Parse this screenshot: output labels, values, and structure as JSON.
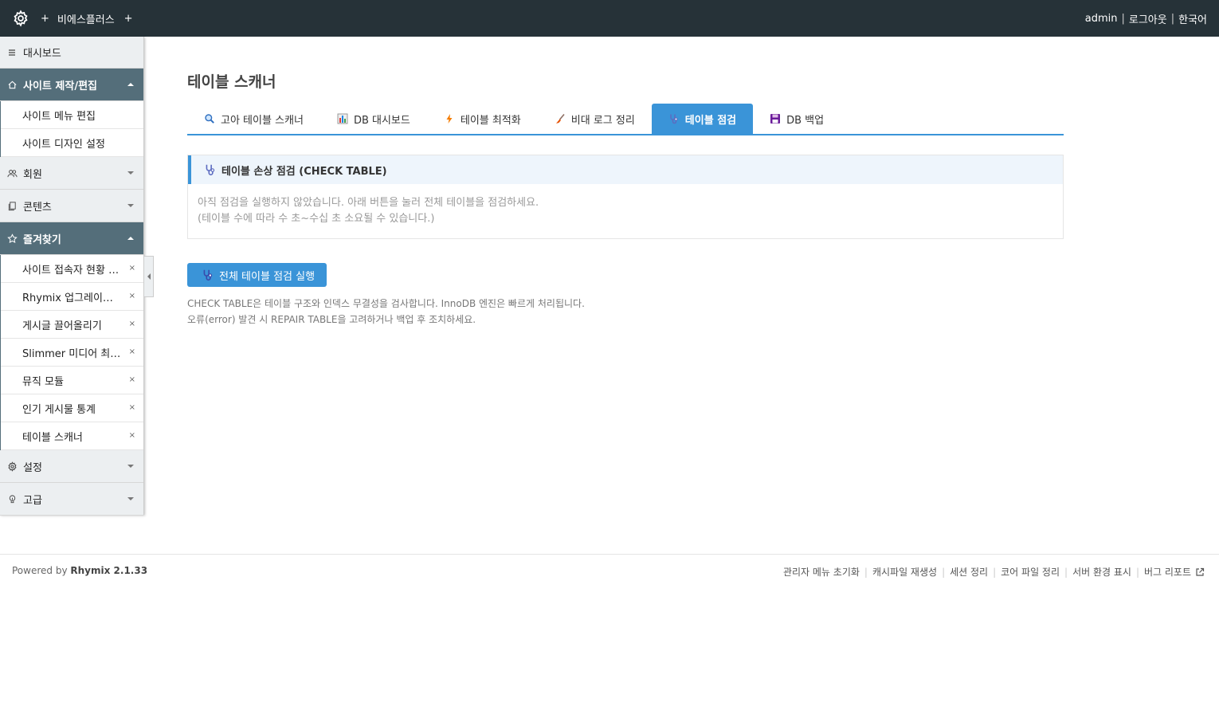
{
  "topbar": {
    "plus_left": "+",
    "site_name": "비에스플러스",
    "plus_right": "+",
    "user": "admin",
    "separator": "|",
    "logout": "로그아웃",
    "language": "한국어"
  },
  "sidebar": {
    "dashboard": "대시보드",
    "site_edit": {
      "label": "사이트 제작/편집",
      "items": [
        "사이트 메뉴 편집",
        "사이트 디자인 설정"
      ]
    },
    "member": "회원",
    "contents": "콘텐츠",
    "favorites": {
      "label": "즐겨찾기",
      "remove_glyph": "×",
      "items": [
        "사이트 접속자 현황 보기",
        "Rhymix 업그레이드 도우미",
        "게시글 끌어올리기",
        "Slimmer 미디어 최적화",
        "뮤직 모듈",
        "인기 게시물 통계",
        "테이블 스캐너"
      ]
    },
    "settings": "설정",
    "advanced": "고급"
  },
  "main": {
    "title": "테이블 스캐너",
    "tabs": [
      {
        "label": "고아 테이블 스캐너",
        "icon": "magnifier-icon"
      },
      {
        "label": "DB 대시보드",
        "icon": "bar-chart-icon"
      },
      {
        "label": "테이블 최적화",
        "icon": "lightning-icon"
      },
      {
        "label": "비대 로그 정리",
        "icon": "broom-icon"
      },
      {
        "label": "테이블 점검",
        "icon": "stethoscope-icon",
        "active": true
      },
      {
        "label": "DB 백업",
        "icon": "floppy-disk-icon"
      }
    ],
    "panel": {
      "title": "테이블 손상 점검 (CHECK TABLE)",
      "line1": "아직 점검을 실행하지 않았습니다. 아래 버튼을 눌러 전체 테이블을 점검하세요.",
      "line2": "(테이블 수에 따라 수 초~수십 초 소요될 수 있습니다.)"
    },
    "run_button": "전체 테이블 점검 실행",
    "note1": "CHECK TABLE은 테이블 구조와 인덱스 무결성을 검사합니다. InnoDB 엔진은 빠르게 처리됩니다.",
    "note2": "오류(error) 발견 시 REPAIR TABLE을 고려하거나 백업 후 조치하세요."
  },
  "footer": {
    "powered_prefix": "Powered by",
    "powered_brand": "Rhymix 2.1.33",
    "links": [
      "관리자 메뉴 초기화",
      "캐시파일 재생성",
      "세션 정리",
      "코어 파일 정리",
      "서버 환경 표시",
      "버그 리포트"
    ],
    "separator": "|"
  },
  "colors": {
    "topbar": "#263238",
    "sidebar_active": "#546e7a",
    "accent": "#3a94d8"
  }
}
